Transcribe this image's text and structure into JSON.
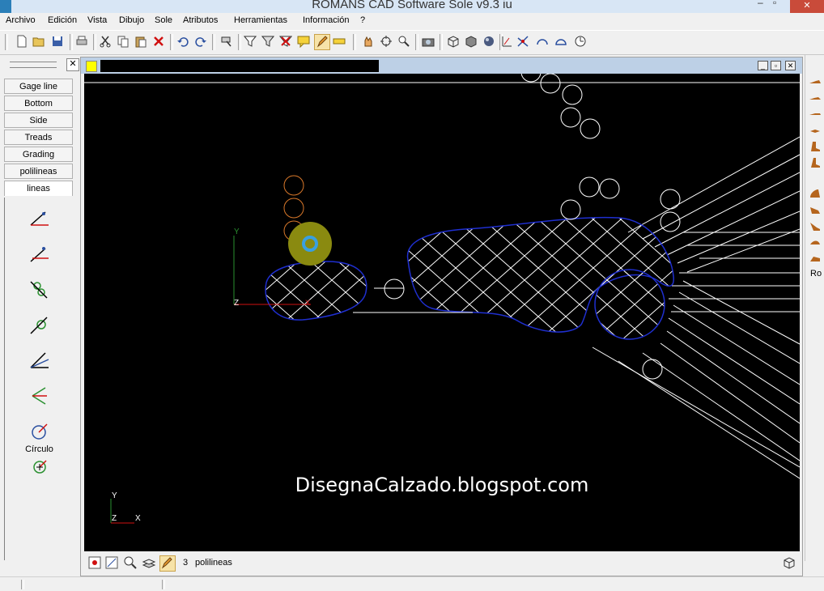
{
  "window": {
    "title": "ROMANS CAD Software Sole v9.3 iu",
    "minimize_glyph": "–",
    "maximize_glyph": "▫",
    "close_glyph": "✕"
  },
  "menu": [
    "Archivo",
    "Edición",
    "Vista",
    "Dibujo",
    "Sole",
    "Atributos",
    "Herramientas",
    "Información",
    "?"
  ],
  "left_panel": {
    "close_glyph": "✕",
    "tabs": [
      "Gage line",
      "Bottom",
      "Side",
      "Treads",
      "Grading",
      "polilineas",
      "lineas"
    ],
    "active_tab": "lineas",
    "circle_label": "Círculo"
  },
  "drawing": {
    "watermark": "DisegnaCalzado.blogspot.com",
    "axis_y": "Y",
    "axis_x": "X",
    "axis_z": "Z",
    "colors": {
      "background": "#000000",
      "hatch": "#ffffff",
      "outline": "#1f2fd0",
      "orange_circles": "#d9782a",
      "cursor_halo": "#8a8a10",
      "cursor_ring": "#3aa0e0"
    }
  },
  "mdi": {
    "min_glyph": "_",
    "max_glyph": "▫",
    "close_glyph": "✕"
  },
  "status": {
    "layer_number": "3",
    "layer_name": "polilineas"
  },
  "right_panel": {
    "label": "Ro"
  }
}
